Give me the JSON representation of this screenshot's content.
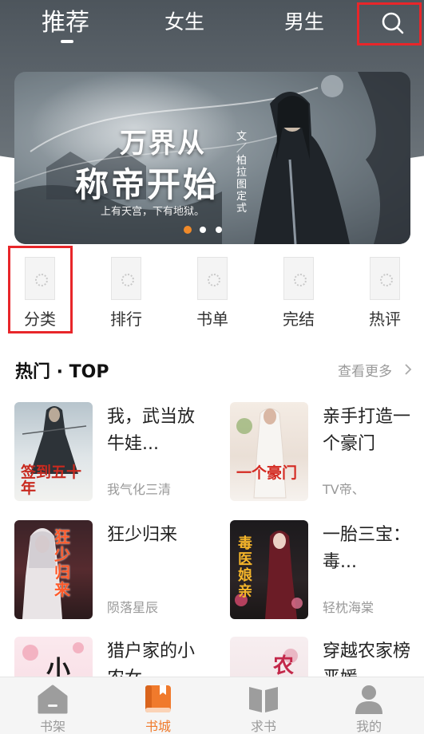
{
  "header": {
    "tabs": [
      {
        "label": "推荐",
        "active": true
      },
      {
        "label": "女生",
        "active": false
      },
      {
        "label": "男生",
        "active": false
      }
    ]
  },
  "banner": {
    "title_line1": "万界从",
    "title_line2": "称帝开始",
    "subtitle": "上有天宫，下有地狱。",
    "author": "文／柏拉图定式",
    "slide_count": 3,
    "active_slide": 0
  },
  "categories": [
    {
      "label": "分类"
    },
    {
      "label": "排行"
    },
    {
      "label": "书单"
    },
    {
      "label": "完结"
    },
    {
      "label": "热评"
    }
  ],
  "hot": {
    "title": "热门 · TOP",
    "more": "查看更多",
    "books": [
      {
        "title": "我，武当放牛娃...",
        "author": "我气化三清",
        "cover_text": "签到五十年"
      },
      {
        "title": "亲手打造一个豪门",
        "author": "TV帝、",
        "cover_text": "一个豪门"
      },
      {
        "title": "狂少归来",
        "author": "陨落星辰",
        "cover_text": "狂少归来"
      },
      {
        "title": "一胎三宝：毒...",
        "author": "轻枕海棠",
        "cover_text": "毒医娘亲"
      },
      {
        "title": "猎户家的小农女",
        "author": "",
        "cover_text": "小"
      },
      {
        "title": "穿越农家榜恶媛",
        "author": "",
        "cover_text": "农"
      }
    ]
  },
  "bottom_nav": [
    {
      "label": "书架",
      "icon": "bookshelf-icon",
      "active": false
    },
    {
      "label": "书城",
      "icon": "bookstore-icon",
      "active": true
    },
    {
      "label": "求书",
      "icon": "open-book-icon",
      "active": false
    },
    {
      "label": "我的",
      "icon": "user-icon",
      "active": false
    }
  ],
  "colors": {
    "accent": "#f07a2c",
    "highlight": "#e8262a"
  }
}
